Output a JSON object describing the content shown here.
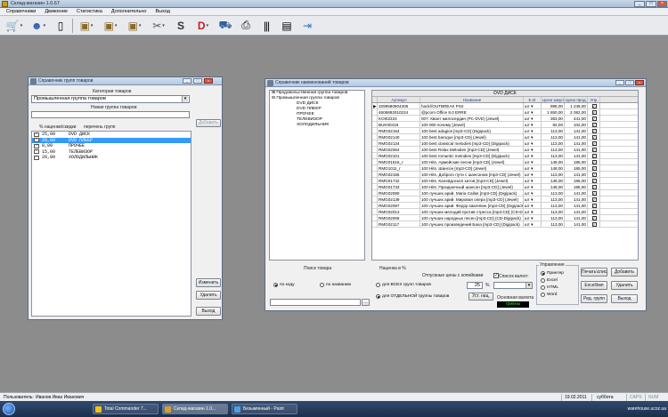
{
  "app": {
    "title": "Склад-магазин 1.0.67"
  },
  "menu": [
    "Справочники",
    "Движение",
    "Статистика",
    "Дополнительно",
    "Выход"
  ],
  "toolbar": {
    "buttons": [
      {
        "icon": "cart-icon",
        "dropdown": true
      },
      {
        "icon": "person-icon",
        "dropdown": true
      },
      {
        "icon": "document-icon",
        "dropdown": false
      },
      {
        "icon": "box-in-icon",
        "dropdown": true
      },
      {
        "icon": "box-out-icon",
        "dropdown": true
      },
      {
        "icon": "box-return-icon",
        "dropdown": true
      },
      {
        "icon": "tools-icon",
        "dropdown": true
      },
      {
        "icon": "s-icon",
        "dropdown": false
      },
      {
        "icon": "d-icon",
        "dropdown": true
      },
      {
        "icon": "truck-icon",
        "dropdown": false
      },
      {
        "icon": "printer-icon",
        "dropdown": false
      },
      {
        "icon": "barcode-icon",
        "dropdown": false
      },
      {
        "icon": "notes-icon",
        "dropdown": false
      },
      {
        "icon": "exit-door-icon",
        "dropdown": false
      }
    ]
  },
  "groups_window": {
    "title": "Справочник групп товаров",
    "category_label": "Категории товаров",
    "category_value": "Промышленная группа товаров",
    "new_group_label": "Новая группа товаров:",
    "new_group_value": "",
    "add_button": "Добавить",
    "col_markup": "% наценки/скидки",
    "col_list": "перечень групп",
    "rows": [
      {
        "markup": "25,00",
        "name": "DVD ДИСК",
        "checked": true,
        "selected": false
      },
      {
        "markup": "20,00",
        "name": "DVD ПЛЕЕР",
        "checked": true,
        "selected": true
      },
      {
        "markup": "0,00",
        "name": "ПРОЧЕЕ",
        "checked": true,
        "selected": false
      },
      {
        "markup": "15,00",
        "name": "ТЕЛЕВИЗОР",
        "checked": true,
        "selected": false
      },
      {
        "markup": "20,00",
        "name": "ХОЛОДИЛЬНИК",
        "checked": true,
        "selected": false
      }
    ],
    "buttons": {
      "edit": "Изменить",
      "delete": "Удалить",
      "exit": "Выход"
    }
  },
  "products_window": {
    "title": "Справочник наименований товаров",
    "tree": [
      {
        "label": "Продовольственная группа товаров",
        "level": 0,
        "toggle": "+"
      },
      {
        "label": "Промышленная группа товаров",
        "level": 0,
        "toggle": "−"
      },
      {
        "label": "DVD ДИСК",
        "level": 1,
        "toggle": ""
      },
      {
        "label": "DVD ПЛЕЕР",
        "level": 1,
        "toggle": ""
      },
      {
        "label": "ПРОЧЕЕ",
        "level": 1,
        "toggle": ""
      },
      {
        "label": "ТЕЛЕВИЗОР",
        "level": 1,
        "toggle": ""
      },
      {
        "label": "ХОЛОДИЛЬНИК",
        "level": 1,
        "toggle": ""
      }
    ],
    "table": {
      "caption": "DVD ДИСК",
      "headers": [
        "",
        "Артикул",
        "Название",
        "Е.И.",
        "Цена закуп.",
        "Цена прод.",
        "Упр."
      ],
      "rows": [
        [
          "▶",
          "3299580804306",
          "hack//OUTBREAK PS2",
          "шт",
          "998,00",
          "1 248,00"
        ],
        [
          "",
          "4606892010224",
          "@pcom Office 8.0 ERRE",
          "шт",
          "1 650,00",
          "2 062,00"
        ],
        [
          "",
          "KOI02224",
          "007: Квант милосердия (PC-DVD) [Jewel]",
          "шт",
          "353,00",
          "441,00"
        ],
        [
          "",
          "BUK00418",
          "100 000 почему [Jewel]",
          "шт",
          "82,00",
          "102,00"
        ],
        [
          "",
          "RMG02154",
          "100 best adagios [mp3-CD] (Digipack)",
          "шт",
          "113,00",
          "141,00"
        ],
        [
          "",
          "RMG02140",
          "100 best baroque [mp3-CD] (Jewel)",
          "шт",
          "113,00",
          "141,00"
        ],
        [
          "",
          "RMG02134",
          "100 best classical melodies [mp3-CD] (Digipack)",
          "шт",
          "113,00",
          "141,00"
        ],
        [
          "",
          "RMG02064",
          "100 best Relax Melodies [mp3-CD] (Jewel)",
          "шт",
          "113,00",
          "141,00"
        ],
        [
          "",
          "RMG02101",
          "100 best romantic melodies [mp3-CD] (Digipack)",
          "шт",
          "113,00",
          "141,00"
        ],
        [
          "",
          "RMG01516_r",
          "100 Hits. Армейские песни [mp3-CD] (Jewel)",
          "шт",
          "148,00",
          "185,00"
        ],
        [
          "",
          "RMG1011_r",
          "100 Hits. Шансон [mp3-CD] (Jewel)",
          "шт",
          "148,00",
          "185,00"
        ],
        [
          "",
          "RMG02155",
          "100 Hits. Доброго пути с шансоном [mp3-CD] (Jewel)",
          "шт",
          "113,00",
          "141,00"
        ],
        [
          "",
          "RMG01742",
          "100 Hits. Калейдоскоп хитов [mp3-CD] (Jewel)",
          "шт",
          "148,00",
          "185,00"
        ],
        [
          "",
          "RMG01733",
          "100 Hits. Праздничный шансон [mp3-CD] (Jewel)",
          "шт",
          "148,00",
          "185,00"
        ],
        [
          "",
          "RMG02080",
          "100 лучших арий. Maria Callas [mp3-CD] (Digipack)",
          "шт",
          "113,00",
          "141,00"
        ],
        [
          "",
          "RMG02139",
          "100 лучших арий. Мировая опера [mp3-CD] (Jewel)",
          "шт",
          "113,00",
          "141,00"
        ],
        [
          "",
          "RMG02087",
          "100 лучших арий. Федор Шаляпин [mp3-CD] (Digipack)",
          "шт",
          "113,00",
          "141,00"
        ],
        [
          "",
          "RMG02013",
          "100 лучших мелодий против стресса [mp3-CD] (CD-Digipack)",
          "шт",
          "113,00",
          "141,00"
        ],
        [
          "",
          "RMG02006",
          "100 лучших народных песен [mp3-CD] (CD-Digipack)",
          "шт",
          "113,00",
          "141,00"
        ],
        [
          "",
          "RMG02117",
          "100 лучших произведений Баха [mp3-CD] (Digipack)",
          "шт",
          "113,00",
          "141,00"
        ]
      ]
    },
    "search": {
      "title": "Поиск товара",
      "by_code": "по коду",
      "by_name": "по названию",
      "query": ""
    },
    "markup": {
      "title": "Наценка в %",
      "round_label": "Отпускные цены с копейками",
      "all_groups": "для ВСЕХ групп товаров",
      "single_group": "для ОТДЕЛЬНОЙ группы товаров",
      "value": "25",
      "unit": "%",
      "set_button": "Уст. нац."
    },
    "currency": {
      "title": "Список валют:",
      "value": "",
      "base_label": "Основная валюта",
      "base_value": "гривны"
    },
    "control": {
      "title": "Управление",
      "options": [
        "Принтер",
        "Excel",
        "HTML",
        "Word"
      ],
      "selected": "Принтер"
    },
    "buttons": {
      "print_list": "Печать\\спис.",
      "add": "Добавить",
      "excel_import": "Excel\\Імп",
      "delete": "Удалить",
      "edit_group": "Ред. групп",
      "exit": "Выход"
    }
  },
  "statusbar": {
    "user_label": "Пользователь:",
    "user_name": "Иванов Иван Иванович",
    "date": "19.02.2011",
    "day": "суббота",
    "caps": "CAPS",
    "num": "NUM"
  },
  "taskbar": {
    "tasks": [
      {
        "label": "Total Commander 7...",
        "color": "#f0c020",
        "active": false
      },
      {
        "label": "Склад-магазин 1.0...",
        "color": "#d0a030",
        "active": true
      },
      {
        "label": "Безымянный - Paint",
        "color": "#4aa0e0",
        "active": false
      }
    ],
    "tray_text": "warehouse.ucoz.ua"
  }
}
